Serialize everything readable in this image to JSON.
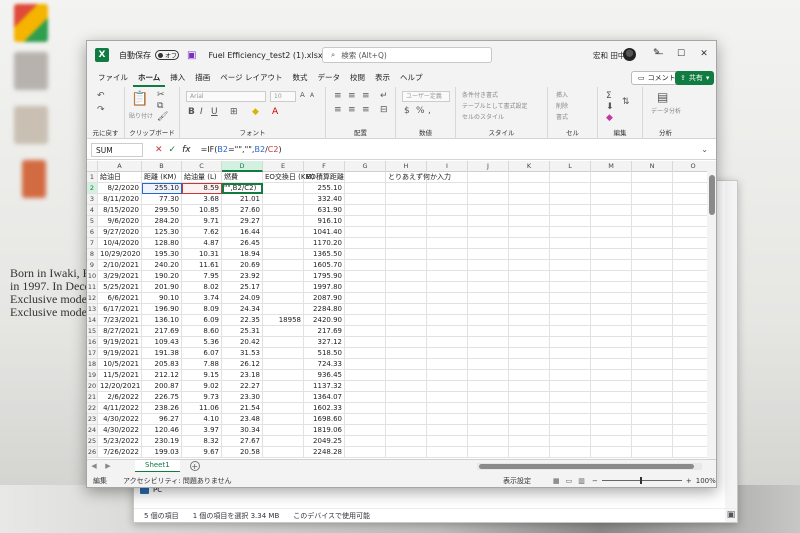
{
  "background": {
    "text_lines": [
      "Born in Iwaki, Fuk",
      "in 1997. In Decem",
      "Exclusive model o",
      "Exclusive model o"
    ]
  },
  "explorer": {
    "pc_label": "PC",
    "status": [
      "5 個の項目",
      "1 個の項目を選択 3.34 MB",
      "このデバイスで使用可能"
    ]
  },
  "titlebar": {
    "autosave_label": "自動保存",
    "autosave_state": "オフ",
    "filename": "Fuel Efficiency_test2 (1).xlsx",
    "search_placeholder": "検索 (Alt+Q)",
    "user_name": "宏和 田中"
  },
  "menu": {
    "tabs": [
      "ファイル",
      "ホーム",
      "挿入",
      "描画",
      "ページ レイアウト",
      "数式",
      "データ",
      "校閲",
      "表示",
      "ヘルプ"
    ],
    "active": "ホーム",
    "comment_label": "コメント",
    "share_label": "共有"
  },
  "ribbon": {
    "undo_label": "元に戻す",
    "clipboard_label": "クリップボード",
    "font_label": "フォント",
    "align_label": "配置",
    "number_label": "数値",
    "style_label": "スタイル",
    "cell_label": "セル",
    "edit_label": "編集",
    "analysis_label": "分析",
    "paste_label": "貼り付け",
    "font_name": "Arial",
    "font_size": "10",
    "number_format": "ユーザー定義",
    "style_items": [
      "条件付き書式",
      "テーブルとして書式設定",
      "セルのスタイル"
    ],
    "cell_items": [
      "挿入",
      "削除",
      "書式"
    ],
    "data_analysis_label": "データ分析"
  },
  "formula_bar": {
    "name_box": "SUM",
    "formula_prefix": "=IF(",
    "ref1": "B2",
    "formula_mid": "=\"\",\"\",",
    "ref1b": "B2",
    "formula_div": "/",
    "ref2": "C2",
    "formula_end": ")"
  },
  "grid": {
    "columns": [
      "A",
      "B",
      "C",
      "D",
      "E",
      "F",
      "G",
      "H",
      "I",
      "J",
      "K",
      "L",
      "M",
      "N",
      "O"
    ],
    "headers": [
      "給油日",
      "距離 (KM)",
      "給油量 (L)",
      "燃費",
      "EO交換日 (KM)",
      "EO積算距離",
      "",
      "とりあえず何か入力"
    ],
    "active_formula_display": "\"\",B2/C2)",
    "rows": [
      [
        "8/2/2020",
        "255.10",
        "8.59",
        "",
        "",
        "255.10"
      ],
      [
        "8/11/2020",
        "77.30",
        "3.68",
        "21.01",
        "",
        "332.40"
      ],
      [
        "8/15/2020",
        "299.50",
        "10.85",
        "27.60",
        "",
        "631.90"
      ],
      [
        "9/6/2020",
        "284.20",
        "9.71",
        "29.27",
        "",
        "916.10"
      ],
      [
        "9/27/2020",
        "125.30",
        "7.62",
        "16.44",
        "",
        "1041.40"
      ],
      [
        "10/4/2020",
        "128.80",
        "4.87",
        "26.45",
        "",
        "1170.20"
      ],
      [
        "10/29/2020",
        "195.30",
        "10.31",
        "18.94",
        "",
        "1365.50"
      ],
      [
        "2/10/2021",
        "240.20",
        "11.61",
        "20.69",
        "",
        "1605.70"
      ],
      [
        "3/29/2021",
        "190.20",
        "7.95",
        "23.92",
        "",
        "1795.90"
      ],
      [
        "5/25/2021",
        "201.90",
        "8.02",
        "25.17",
        "",
        "1997.80"
      ],
      [
        "6/6/2021",
        "90.10",
        "3.74",
        "24.09",
        "",
        "2087.90"
      ],
      [
        "6/17/2021",
        "196.90",
        "8.09",
        "24.34",
        "",
        "2284.80"
      ],
      [
        "7/23/2021",
        "136.10",
        "6.09",
        "22.35",
        "18958",
        "2420.90"
      ],
      [
        "8/27/2021",
        "217.69",
        "8.60",
        "25.31",
        "",
        "217.69"
      ],
      [
        "9/19/2021",
        "109.43",
        "5.36",
        "20.42",
        "",
        "327.12"
      ],
      [
        "9/19/2021",
        "191.38",
        "6.07",
        "31.53",
        "",
        "518.50"
      ],
      [
        "10/5/2021",
        "205.83",
        "7.88",
        "26.12",
        "",
        "724.33"
      ],
      [
        "11/5/2021",
        "212.12",
        "9.15",
        "23.18",
        "",
        "936.45"
      ],
      [
        "12/20/2021",
        "200.87",
        "9.02",
        "22.27",
        "",
        "1137.32"
      ],
      [
        "2/6/2022",
        "226.75",
        "9.73",
        "23.30",
        "",
        "1364.07"
      ],
      [
        "4/11/2022",
        "238.26",
        "11.06",
        "21.54",
        "",
        "1602.33"
      ],
      [
        "4/30/2022",
        "96.27",
        "4.10",
        "23.48",
        "",
        "1698.60"
      ],
      [
        "4/30/2022",
        "120.46",
        "3.97",
        "30.34",
        "",
        "1819.06"
      ],
      [
        "5/23/2022",
        "230.19",
        "8.32",
        "27.67",
        "",
        "2049.25"
      ],
      [
        "7/26/2022",
        "199.03",
        "9.67",
        "20.58",
        "",
        "2248.28"
      ]
    ]
  },
  "sheet_tab": "Sheet1",
  "statusbar": {
    "mode": "編集",
    "accessibility": "アクセシビリティ: 問題ありません",
    "display_settings": "表示設定",
    "zoom": "100%"
  },
  "colors": {
    "excel_green": "#107c41",
    "ref_blue": "#2a65c9",
    "ref_red": "#c43a3a"
  }
}
